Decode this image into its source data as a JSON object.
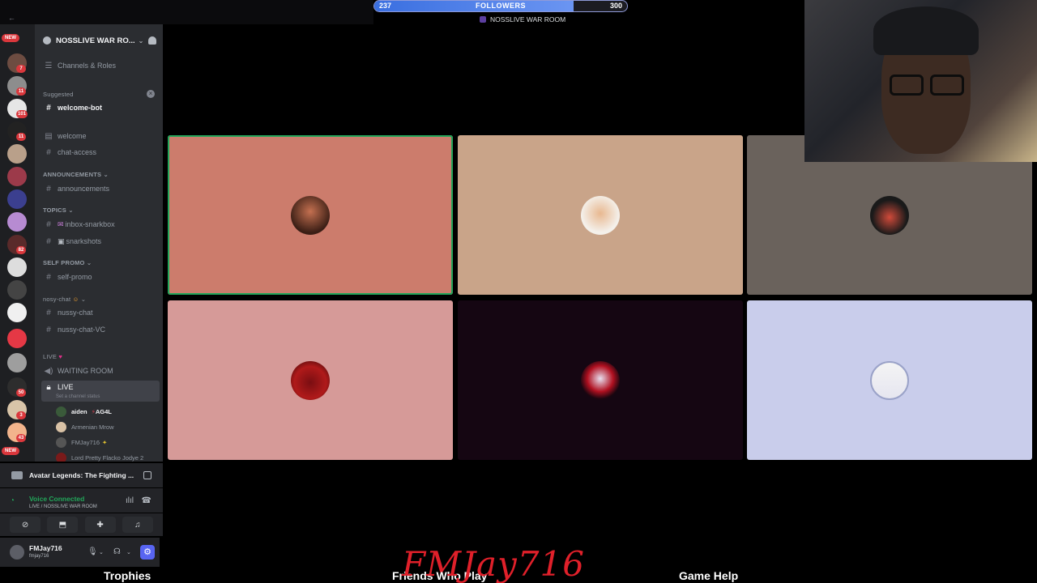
{
  "stream": {
    "followers_goal": {
      "current": "237",
      "label": "FOLLOWERS",
      "target": "300",
      "progress": 0.79
    },
    "room_title": "NOSSLIVE WAR ROOM",
    "handle": "FMJay716",
    "bottom_labels": [
      "Trophies",
      "Friends Who Play",
      "Game Help"
    ]
  },
  "rail": {
    "new_top": "NEW",
    "new_bottom": "NEW",
    "badges": [
      "7",
      "11",
      "101",
      "11",
      "82",
      "50",
      "3",
      "43"
    ]
  },
  "sidebar": {
    "server_name": "NOSSLIVE WAR RO...",
    "channels_roles": "Channels & Roles",
    "suggested": "Suggested",
    "welcome_bot": "welcome-bot",
    "ch_welcome": "welcome",
    "ch_chat_access": "chat-access",
    "cat_announcements": "ANNOUNCEMENTS",
    "ch_announcements": "announcements",
    "cat_topics": "TOPICS",
    "ch_inbox": "inbox-snarkbox",
    "ch_snarkshots": "snarkshots",
    "cat_self_promo": "SELF PROMO",
    "ch_self_promo": "self-promo",
    "cat_nosy": "nosy-chat",
    "ch_nussy_chat": "nussy-chat",
    "ch_nussy_vc": "nussy-chat-VC",
    "cat_live": "LIVE",
    "ch_waiting": "WAITING ROOM",
    "ch_live": "LIVE",
    "live_status": "Set a channel status",
    "voice_users": [
      "aiden",
      "Armenian Mrow",
      "FMJay716",
      "Lord Pretty Flacko Jodye 2"
    ],
    "aiden_tag": "AG4L"
  },
  "activity": {
    "game": "Avatar Legends: The Fighting ..."
  },
  "voice": {
    "status": "Voice Connected",
    "location": "LIVE / NOSSLIVE WAR ROOM"
  },
  "user": {
    "name": "FMJay716",
    "handle": "fmjay716"
  },
  "tiles": [
    {
      "bg": "#cc7c6c"
    },
    {
      "bg": "#c9a489"
    },
    {
      "bg": "#6a625c"
    },
    {
      "bg": "#d69a98"
    },
    {
      "bg": "#150612"
    },
    {
      "bg": "#c9cdeb"
    }
  ]
}
